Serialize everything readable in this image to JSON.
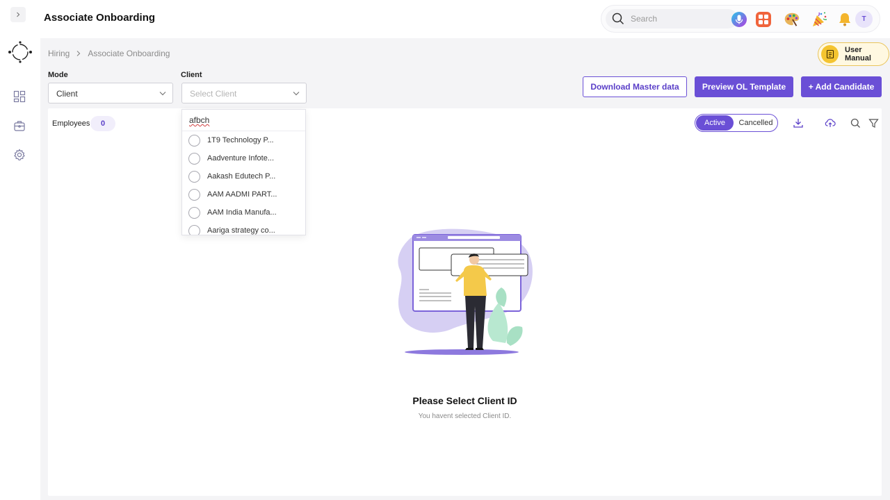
{
  "header": {
    "title": "Associate Onboarding",
    "search_placeholder": "Search",
    "avatar_initial": "T"
  },
  "breadcrumb": {
    "items": [
      "Hiring",
      "Associate Onboarding"
    ]
  },
  "user_manual_label": "User Manual",
  "filters": {
    "mode_label": "Mode",
    "mode_value": "Client",
    "client_label": "Client",
    "client_placeholder": "Select Client"
  },
  "buttons": {
    "download_master": "Download Master data",
    "preview_ol": "Preview OL Template",
    "add_candidate": "+ Add Candidate"
  },
  "employees": {
    "label": "Employees",
    "count": "0"
  },
  "status_toggle": {
    "active": "Active",
    "cancelled": "Cancelled"
  },
  "empty_state": {
    "title": "Please Select Client ID",
    "subtitle": "You havent selected Client ID."
  },
  "client_dropdown": {
    "search_value": "afbch",
    "options": [
      "1T9 Technology P...",
      "Aadventure Infote...",
      "Aakash Edutech P...",
      "AAM AADMI PART...",
      "AAM India Manufa...",
      "Aariga strategy co..."
    ]
  },
  "colors": {
    "accent": "#6a4fd6",
    "main_bg": "#f4f4f6",
    "manual_bg": "#fff8e1"
  }
}
